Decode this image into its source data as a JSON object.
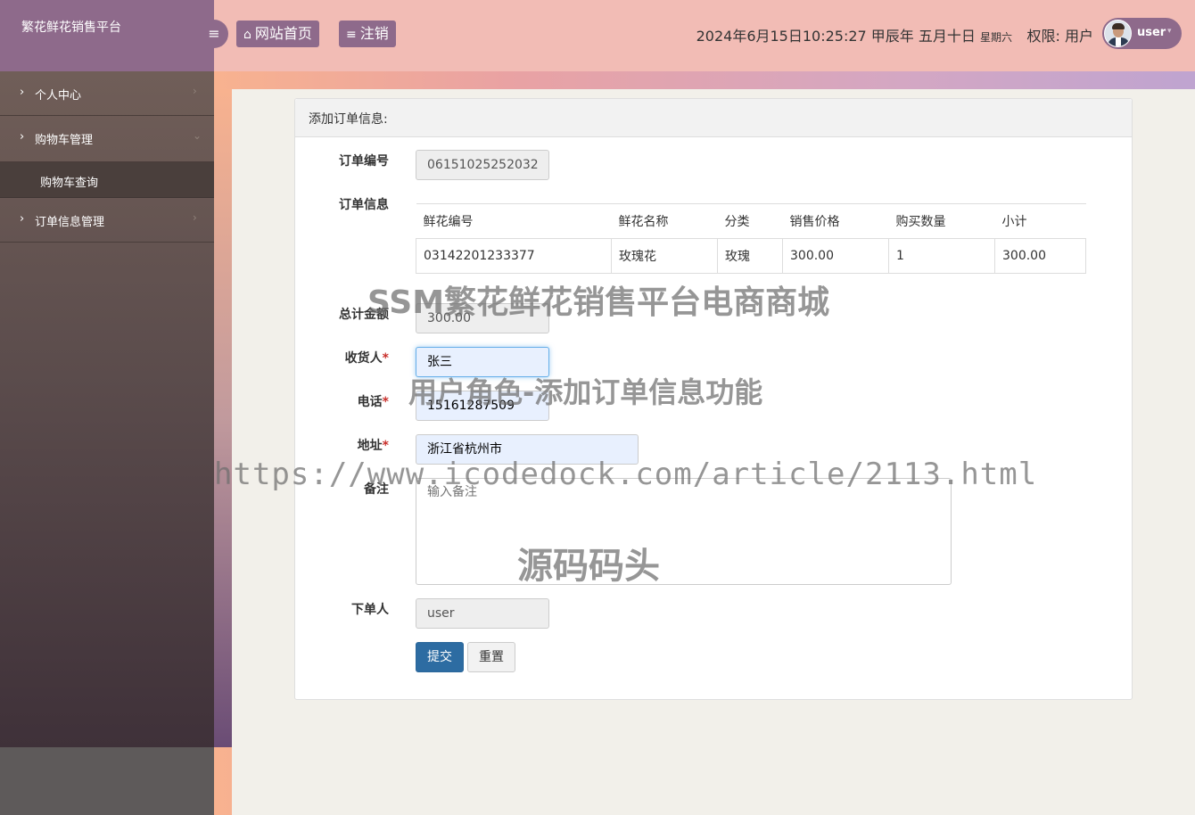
{
  "sidebar": {
    "brand": "繁花鲜花销售平台",
    "items": [
      {
        "label": "个人中心",
        "caret": "›",
        "chevron": "›"
      },
      {
        "label": "购物车管理",
        "caret": "›",
        "chevron": "⌄",
        "sub": [
          {
            "label": "购物车查询"
          }
        ]
      },
      {
        "label": "订单信息管理",
        "caret": "›",
        "chevron": "›"
      }
    ]
  },
  "header": {
    "toggle_icon": "≡",
    "home_icon": "⌂",
    "home_label": "网站首页",
    "logout_icon": "≡",
    "logout_label": "注销",
    "datetime": "2024年6月15日10:25:27 甲辰年 五月十日",
    "weekday": "星期六",
    "permission": "权限: 用户",
    "user": "user",
    "user_caret": "▾"
  },
  "form": {
    "title": "添加订单信息:",
    "order_no_label": "订单编号",
    "order_no_value": "06151025252032",
    "order_info_label": "订单信息",
    "table": {
      "headers": [
        "鲜花编号",
        "鲜花名称",
        "分类",
        "销售价格",
        "购买数量",
        "小计"
      ],
      "rows": [
        [
          "03142201233377",
          "玫瑰花",
          "玫瑰",
          "300.00",
          "1",
          "300.00"
        ]
      ]
    },
    "total_label": "总计金额",
    "total_value": "300.00",
    "receiver_label": "收货人",
    "receiver_value": "张三",
    "phone_label": "电话",
    "phone_value": "15161287509",
    "address_label": "地址",
    "address_value": "浙江省杭州市",
    "remark_label": "备注",
    "remark_placeholder": "输入备注",
    "orderer_label": "下单人",
    "orderer_value": "user",
    "required_mark": "*",
    "submit_label": "提交",
    "reset_label": "重置"
  },
  "watermarks": {
    "line1": "SSM繁花鲜花销售平台电商商城",
    "line2": "用户角色-添加订单信息功能",
    "line3": "https://www.icodedock.com/article/2113.html",
    "line4": "源码码头"
  }
}
